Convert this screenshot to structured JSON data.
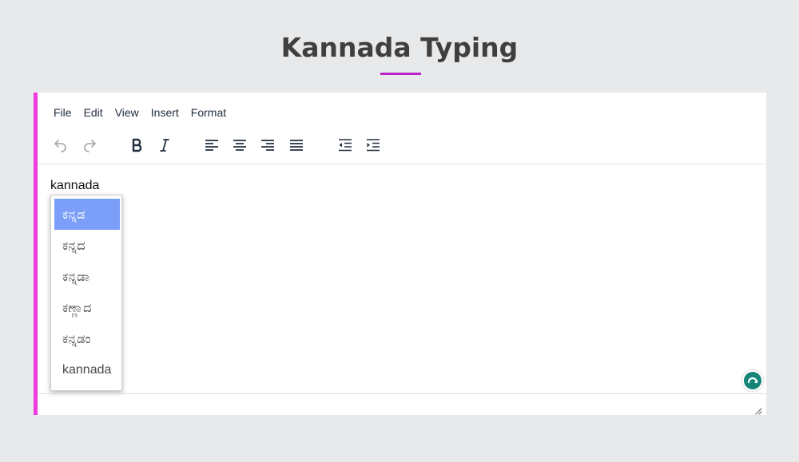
{
  "page": {
    "title": "Kannada Typing"
  },
  "colors": {
    "accent": "#ee3ae0",
    "title_underline": "#b623c6",
    "selected_suggestion": "#7b9ff9",
    "grammar_button": "#15857a"
  },
  "menubar": {
    "items": [
      "File",
      "Edit",
      "View",
      "Insert",
      "Format"
    ]
  },
  "toolbar": {
    "buttons": [
      {
        "name": "undo",
        "icon": "undo-icon"
      },
      {
        "name": "redo",
        "icon": "redo-icon"
      },
      {
        "name": "bold",
        "icon": "bold-icon"
      },
      {
        "name": "italic",
        "icon": "italic-icon"
      },
      {
        "name": "align-left",
        "icon": "align-left-icon"
      },
      {
        "name": "align-center",
        "icon": "align-center-icon"
      },
      {
        "name": "align-right",
        "icon": "align-right-icon"
      },
      {
        "name": "justify",
        "icon": "justify-icon"
      },
      {
        "name": "outdent",
        "icon": "outdent-icon"
      },
      {
        "name": "indent",
        "icon": "indent-icon"
      }
    ]
  },
  "editor": {
    "content": "kannada"
  },
  "suggestions": {
    "selected_index": 0,
    "items": [
      "ಕನ್ನಡ",
      "ಕನ್ನದ",
      "ಕನ್ನಡಾ",
      "ಕಣ್ಣಾದ",
      "ಕನ್ನಡಂ",
      "kannada"
    ]
  }
}
